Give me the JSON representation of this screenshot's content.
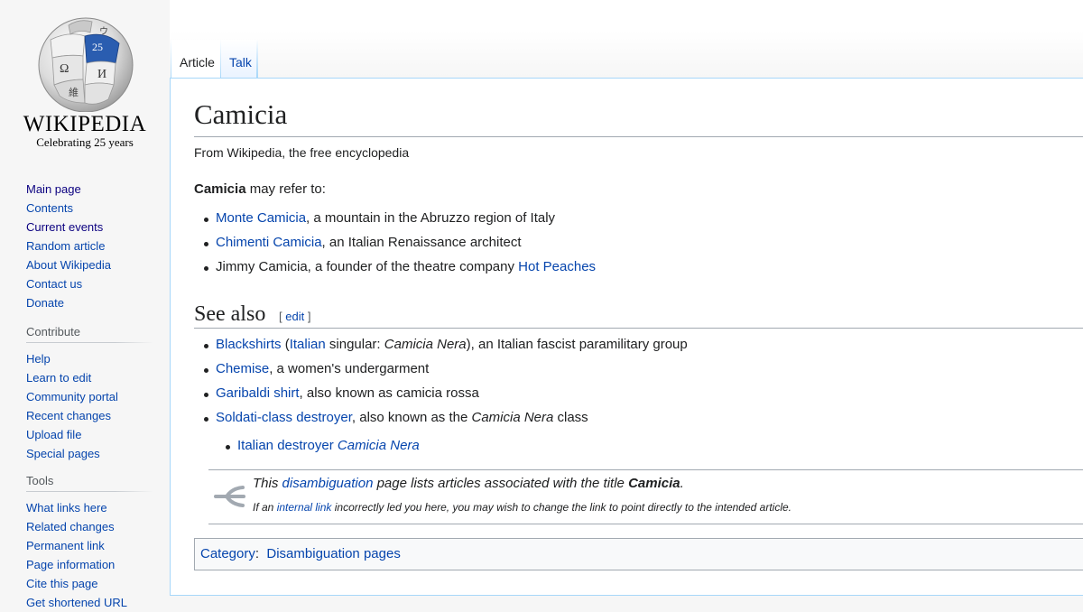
{
  "logo": {
    "wordmark": "WIKIPEDIA",
    "tagline": "Celebrating 25 years",
    "badge": "25"
  },
  "sidebar": {
    "navigation": [
      "Main page",
      "Contents",
      "Current events",
      "Random article",
      "About Wikipedia",
      "Contact us",
      "Donate"
    ],
    "contribute": {
      "heading": "Contribute",
      "items": [
        "Help",
        "Learn to edit",
        "Community portal",
        "Recent changes",
        "Upload file",
        "Special pages"
      ]
    },
    "tools": {
      "heading": "Tools",
      "items": [
        "What links here",
        "Related changes",
        "Permanent link",
        "Page information",
        "Cite this page",
        "Get shortened URL"
      ]
    }
  },
  "tabs": {
    "article": "Article",
    "talk": "Talk"
  },
  "page": {
    "title": "Camicia",
    "site_sub": "From Wikipedia, the free encyclopedia",
    "intro_bold": "Camicia",
    "intro_rest": " may refer to:",
    "list": [
      {
        "link": "Monte Camicia",
        "rest": ", a mountain in the Abruzzo region of Italy"
      },
      {
        "link": "Chimenti Camicia",
        "rest": ", an Italian Renaissance architect"
      },
      {
        "text": "Jimmy Camicia, a founder of the theatre company ",
        "link": "Hot Peaches"
      }
    ],
    "see_also": {
      "heading": "See also",
      "edit_open": "[ ",
      "edit": "edit",
      "edit_close": " ]",
      "blackshirts": {
        "link": "Blackshirts",
        "paren_open": " (",
        "lang": "Italian",
        "mid": " singular: ",
        "italic": "Camicia Nera",
        "rest": "), an Italian fascist paramilitary group"
      },
      "chemise": {
        "link": "Chemise",
        "rest": ", a women's undergarment"
      },
      "garibaldi": {
        "link": "Garibaldi shirt",
        "rest": ", also known as camicia rossa"
      },
      "soldati": {
        "link": "Soldati-class destroyer",
        "rest": ", also known as the ",
        "italic": "Camicia Nera",
        "tail": " class"
      },
      "sub": {
        "link": "Italian destroyer ",
        "italic": "Camicia Nera"
      }
    },
    "disambig": {
      "pre": "This ",
      "link": "disambiguation",
      "mid": " page lists articles associated with the title ",
      "bold": "Camicia",
      "end": ".",
      "sub_pre": "If an ",
      "sub_link": "internal link",
      "sub_rest": " incorrectly led you here, you may wish to change the link to point directly to the intended article."
    },
    "category": {
      "label": "Category",
      "sep": ":  ",
      "value": "Disambiguation pages"
    }
  }
}
